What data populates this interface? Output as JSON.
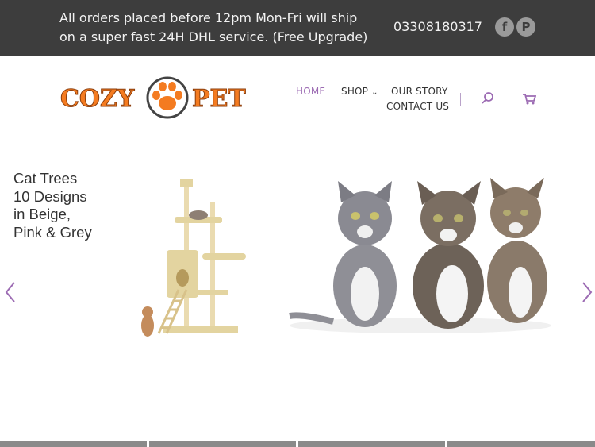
{
  "topbar": {
    "message": "All orders placed before 12pm Mon-Fri will ship on a super fast 24H DHL service. (Free Upgrade)",
    "phone": "03308180317",
    "social": [
      {
        "icon": "facebook-icon",
        "glyph": "f"
      },
      {
        "icon": "pinterest-icon",
        "glyph": "P"
      }
    ]
  },
  "logo": {
    "left_text": "COZY",
    "right_text": "PET",
    "brand_color": "#f47b20"
  },
  "nav": {
    "home": "HOME",
    "shop": "SHOP",
    "our_story": "OUR STORY",
    "contact_us": "CONTACT US",
    "active_color": "#9c6bb3"
  },
  "hero": {
    "lines": [
      "Cat Trees",
      "10 Designs",
      "in Beige,",
      "Pink & Grey"
    ]
  },
  "slider": {
    "dot_count": 4
  }
}
